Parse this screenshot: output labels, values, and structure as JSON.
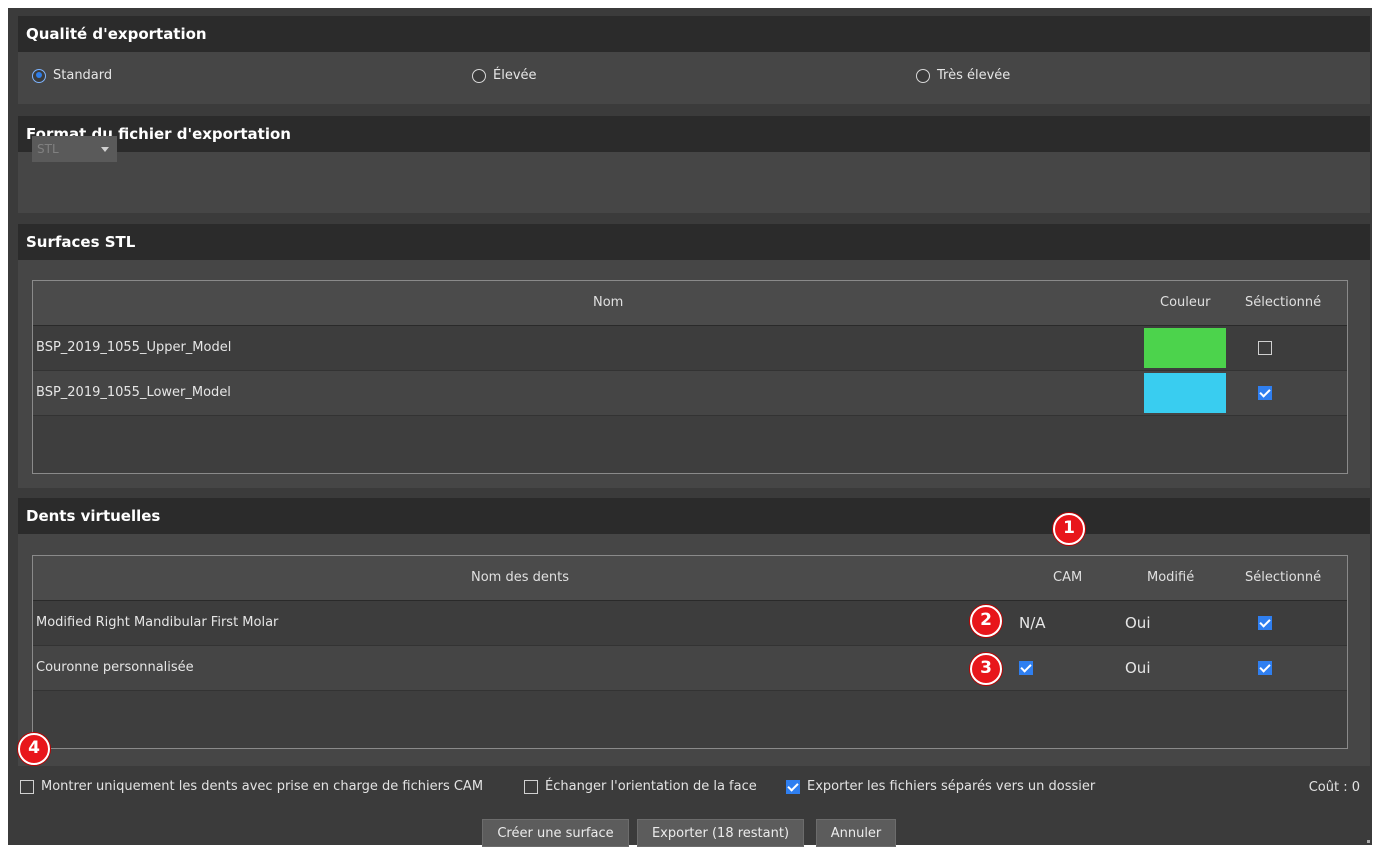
{
  "export_quality": {
    "title": "Qualité d'exportation",
    "options": [
      {
        "label": "Standard",
        "selected": true
      },
      {
        "label": "Élevée",
        "selected": false
      },
      {
        "label": "Très élevée",
        "selected": false
      }
    ]
  },
  "export_format": {
    "title": "Format du fichier d'exportation",
    "selected": "STL"
  },
  "stl_surfaces": {
    "title": "Surfaces STL",
    "columns": {
      "name": "Nom",
      "color": "Couleur",
      "selected": "Sélectionné"
    },
    "rows": [
      {
        "name": "BSP_2019_1055_Upper_Model",
        "color": "#4cd34c",
        "selected": false
      },
      {
        "name": "BSP_2019_1055_Lower_Model",
        "color": "#39cdf0",
        "selected": true
      }
    ]
  },
  "virtual_teeth": {
    "title": "Dents virtuelles",
    "columns": {
      "name": "Nom des dents",
      "cam": "CAM",
      "modified": "Modifié",
      "selected": "Sélectionné"
    },
    "rows": [
      {
        "name": "Modified Right Mandibular First Molar",
        "cam": "N/A",
        "modified": "Oui",
        "selected": true
      },
      {
        "name": "Couronne personnalisée",
        "cam_checked": true,
        "modified": "Oui",
        "selected": true
      }
    ]
  },
  "annotations": {
    "a1": "1",
    "a2": "2",
    "a3": "3",
    "a4": "4"
  },
  "footer": {
    "options": [
      {
        "label": "Montrer uniquement les dents avec prise en charge de fichiers CAM",
        "checked": false
      },
      {
        "label": "Échanger l'orientation de la face",
        "checked": false
      },
      {
        "label": "Exporter les fichiers séparés vers un dossier",
        "checked": true
      }
    ],
    "cost": "Coût : 0",
    "buttons": {
      "create_surface": "Créer une surface",
      "export": "Exporter (18 restant)",
      "cancel": "Annuler"
    }
  }
}
